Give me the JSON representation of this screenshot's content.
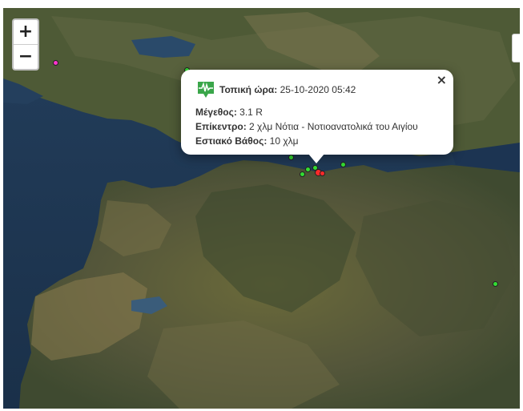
{
  "zoom": {
    "in_label": "+",
    "out_label": "−"
  },
  "popup": {
    "close_label": "×",
    "local_time_label": "Τοπική ώρα:",
    "local_time_value": "25-10-2020 05:42",
    "magnitude_label": "Μέγεθος:",
    "magnitude_value": "3.1 R",
    "epicenter_label": "Επίκεντρο:",
    "epicenter_value": "2 χλμ Νότια - Νοτιοανατολικά του Αιγίου",
    "depth_label": "Εστιακό Βάθος:",
    "depth_value": "10 χλμ",
    "icon": "seismograph-icon"
  },
  "colors": {
    "recent_marker": "#ff2a2a",
    "day_marker": "#33dd33",
    "older_marker": "#ff33cc",
    "popup_icon": "#3aa64a"
  }
}
